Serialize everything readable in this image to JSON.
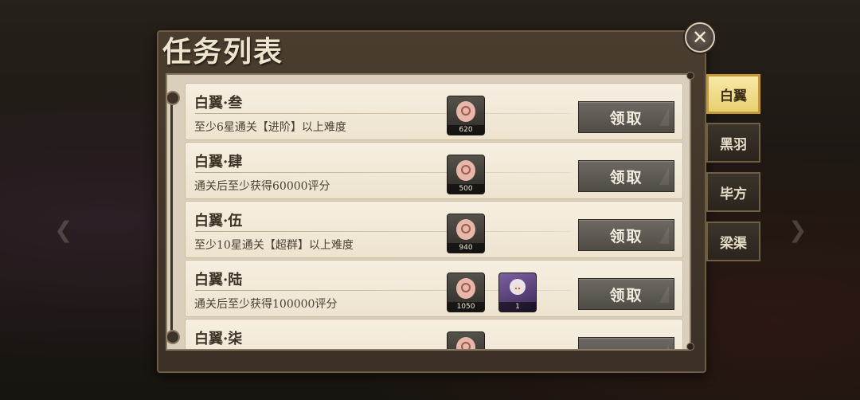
{
  "dialog": {
    "title": "任务列表"
  },
  "tabs": [
    {
      "label": "白翼",
      "active": true
    },
    {
      "label": "黑羽",
      "active": false
    },
    {
      "label": "毕方",
      "active": false
    },
    {
      "label": "梁渠",
      "active": false
    }
  ],
  "tasks": [
    {
      "title": "白翼·叁",
      "desc": "至少6星通关【进阶】以上难度",
      "rewards": [
        {
          "icon": "material-icon",
          "count": "620"
        }
      ],
      "button": "领取"
    },
    {
      "title": "白翼·肆",
      "desc": "通关后至少获得60000评分",
      "rewards": [
        {
          "icon": "material-icon",
          "count": "500"
        }
      ],
      "button": "领取"
    },
    {
      "title": "白翼·伍",
      "desc": "至少10星通关【超群】以上难度",
      "rewards": [
        {
          "icon": "material-icon",
          "count": "940"
        }
      ],
      "button": "领取"
    },
    {
      "title": "白翼·陆",
      "desc": "通关后至少获得100000评分",
      "rewards": [
        {
          "icon": "material-icon",
          "count": "1050"
        },
        {
          "icon": "character-portrait",
          "count": "1"
        }
      ],
      "button": "领取"
    },
    {
      "title": "白翼·柒",
      "desc": "",
      "rewards": [
        {
          "icon": "material-icon",
          "count": ""
        }
      ],
      "button": ""
    }
  ],
  "colors": {
    "accent_gold": "#e8cf6f",
    "panel_brown": "#3b3025",
    "parchment": "#f6efe1"
  }
}
